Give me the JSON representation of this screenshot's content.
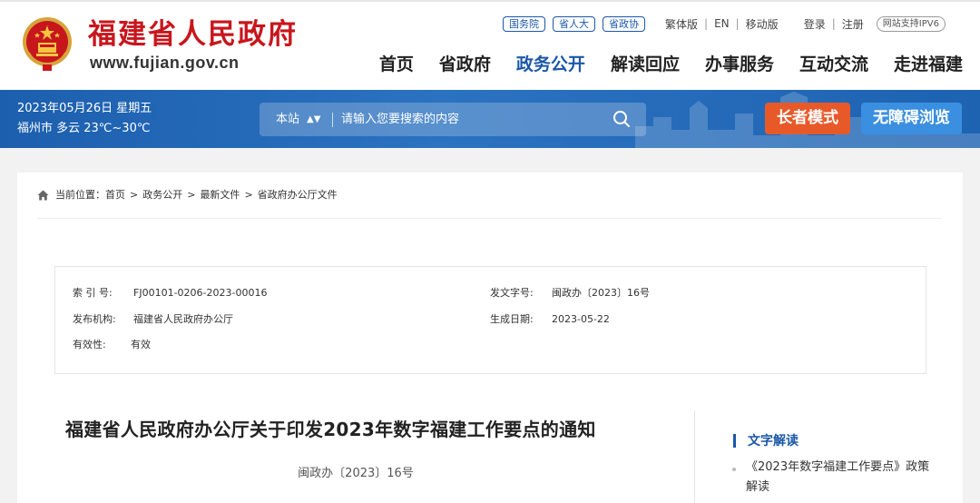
{
  "header": {
    "site_name": "福建省人民政府",
    "site_url": "www.fujian.gov.cn",
    "pills": [
      "国务院",
      "省人大",
      "省政协"
    ],
    "lang_links": [
      "繁体版",
      "EN",
      "移动版"
    ],
    "account_links": [
      "登录",
      "注册"
    ],
    "ipv6_badge": "网站支持IPV6",
    "nav": [
      {
        "label": "首页",
        "active": false
      },
      {
        "label": "省政府",
        "active": false
      },
      {
        "label": "政务公开",
        "active": true
      },
      {
        "label": "解读回应",
        "active": false
      },
      {
        "label": "办事服务",
        "active": false
      },
      {
        "label": "互动交流",
        "active": false
      },
      {
        "label": "走进福建",
        "active": false
      }
    ]
  },
  "band": {
    "date": "2023年05月26日 星期五",
    "weather": "福州市 多云 23℃~30℃",
    "search_scope": "本站",
    "search_placeholder": "请输入您要搜索的内容",
    "elder_mode": "长者模式",
    "accessible_mode": "无障碍浏览"
  },
  "breadcrumb": {
    "prefix": "当前位置：",
    "items": [
      "首页",
      "政务公开",
      "最新文件",
      "省政府办公厅文件"
    ]
  },
  "meta": {
    "index_label": "索 引 号:",
    "index_value": "FJ00101-0206-2023-00016",
    "doc_no_label": "发文字号:",
    "doc_no_value": "闽政办〔2023〕16号",
    "publisher_label": "发布机构:",
    "publisher_value": "福建省人民政府办公厅",
    "date_label": "生成日期:",
    "date_value": "2023-05-22",
    "validity_label": "有效性:",
    "validity_value": "有效"
  },
  "document": {
    "title": "福建省人民政府办公厅关于印发2023年数字福建工作要点的通知",
    "number": "闽政办〔2023〕16号"
  },
  "sidebar": {
    "heading": "文字解读",
    "link": "《2023年数字福建工作要点》政策解读"
  },
  "colors": {
    "brand_red": "#c8161d",
    "brand_blue": "#1b57a8",
    "elder_orange": "#e8592a",
    "access_blue": "#3b8fe0"
  }
}
